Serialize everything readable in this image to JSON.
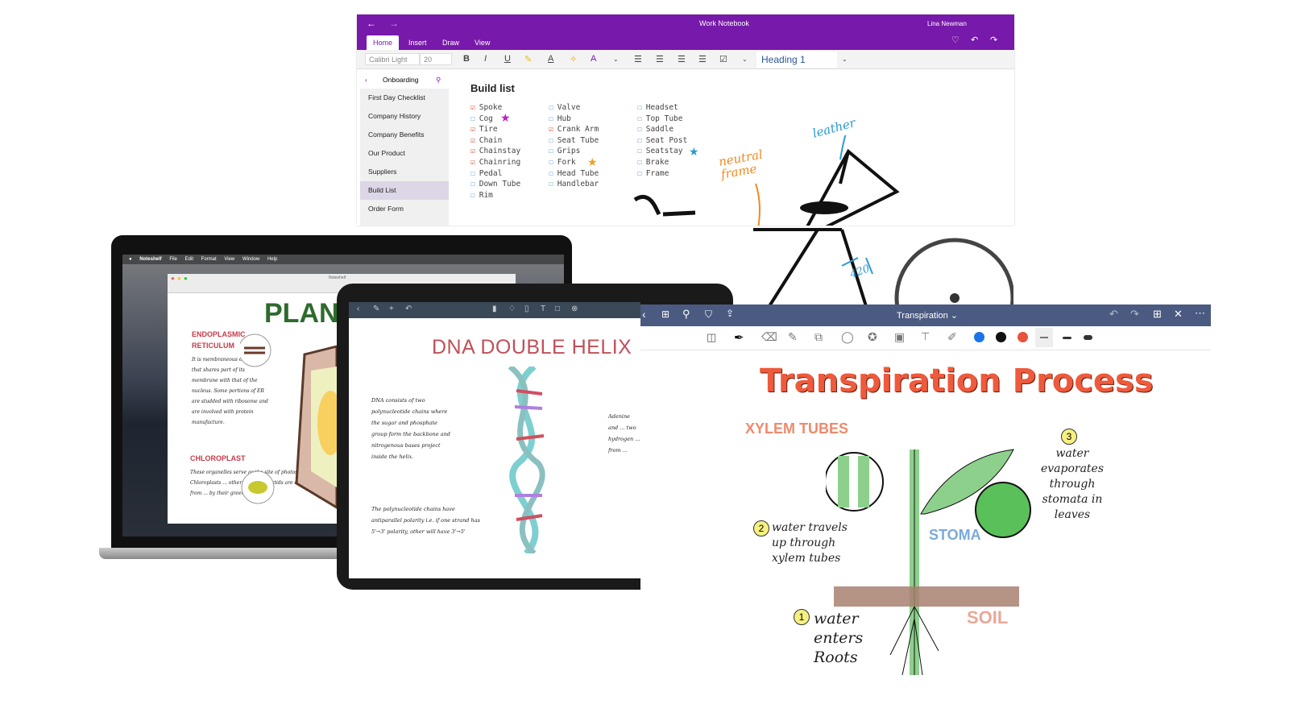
{
  "onenote": {
    "title": "Work Notebook",
    "user": "Lina Newman",
    "tabs": [
      "Home",
      "Insert",
      "Draw",
      "View"
    ],
    "font": "Calibri Light",
    "font_size": "20",
    "style": "Heading 1",
    "section": "Onboarding",
    "pages": [
      "First Day Checklist",
      "Company History",
      "Company Benefits",
      "Our Product",
      "Suppliers",
      "Build List",
      "Order Form"
    ],
    "selected_page": "Build List",
    "page_title": "Build list",
    "columns": [
      [
        {
          "t": "Spoke",
          "c": true
        },
        {
          "t": "Cog",
          "c": false
        },
        {
          "t": "Tire",
          "c": true
        },
        {
          "t": "Chain",
          "c": true
        },
        {
          "t": "Chainstay",
          "c": true
        },
        {
          "t": "Chainring",
          "c": true
        },
        {
          "t": "Pedal",
          "c": false
        },
        {
          "t": "Down Tube",
          "c": false
        },
        {
          "t": "Rim",
          "c": false
        }
      ],
      [
        {
          "t": "Valve",
          "c": false
        },
        {
          "t": "Hub",
          "c": false
        },
        {
          "t": "Crank Arm",
          "c": true
        },
        {
          "t": "Seat Tube",
          "c": false
        },
        {
          "t": "Grips",
          "c": false
        },
        {
          "t": "Fork",
          "c": false
        },
        {
          "t": "Head Tube",
          "c": false
        },
        {
          "t": "Handlebar",
          "c": false
        }
      ],
      [
        {
          "t": "Headset",
          "c": false
        },
        {
          "t": "Top Tube",
          "c": false
        },
        {
          "t": "Saddle",
          "c": false
        },
        {
          "t": "Seat Post",
          "c": false
        },
        {
          "t": "Seatstay",
          "c": false
        },
        {
          "t": "Brake",
          "c": false
        },
        {
          "t": "Frame",
          "c": false
        }
      ]
    ],
    "ink": {
      "neutral": "neutral frame",
      "leather": "leather",
      "num": "420"
    },
    "accent": "#7719aa"
  },
  "mac": {
    "menu": [
      "Noteshelf",
      "File",
      "Edit",
      "Format",
      "View",
      "Window",
      "Help"
    ],
    "window_title": "Noteshelf",
    "title": "PLANT",
    "h1": "ENDOPLASMIC RETICULUM",
    "p1": "It is membraneous organelle that shares part of its membrane with that of the nucleus. Some portions of ER are studded with ribosome and are involved with protein manufacture.",
    "h2": "CHLOROPLAST",
    "p2": "These organelles serve as the site of photosynthesis. Chloroplasts ... other types of plastids are distinguished from ... by their green color."
  },
  "ipad": {
    "title": "DNA DOUBLE HELIX",
    "p1": "DNA consists of two polynucleotide chains where the sugar and phosphate group form the backbone and nitrogenous bases project inside the helix.",
    "p2": "The polynucleotide chains have antiparallel polarity i.e. if one strand has 5'→3' polarity, other will have 3'→5'",
    "p3": "Adenine and ... two hydrogen ... from ..."
  },
  "transpiration": {
    "notebook": "Transpiration",
    "title": "Transpiration Process",
    "xylem": "XYLEM TUBES",
    "stoma": "STOMA",
    "soil": "SOIL",
    "step1": "water enters Roots",
    "step2": "water travels up through xylem tubes",
    "step3": "water evaporates through stomata in leaves",
    "n1": "1",
    "n2": "2",
    "n3": "3",
    "colors": [
      "#1a73e8",
      "#111111",
      "#e8553a"
    ],
    "accent": "#4b5a80"
  }
}
